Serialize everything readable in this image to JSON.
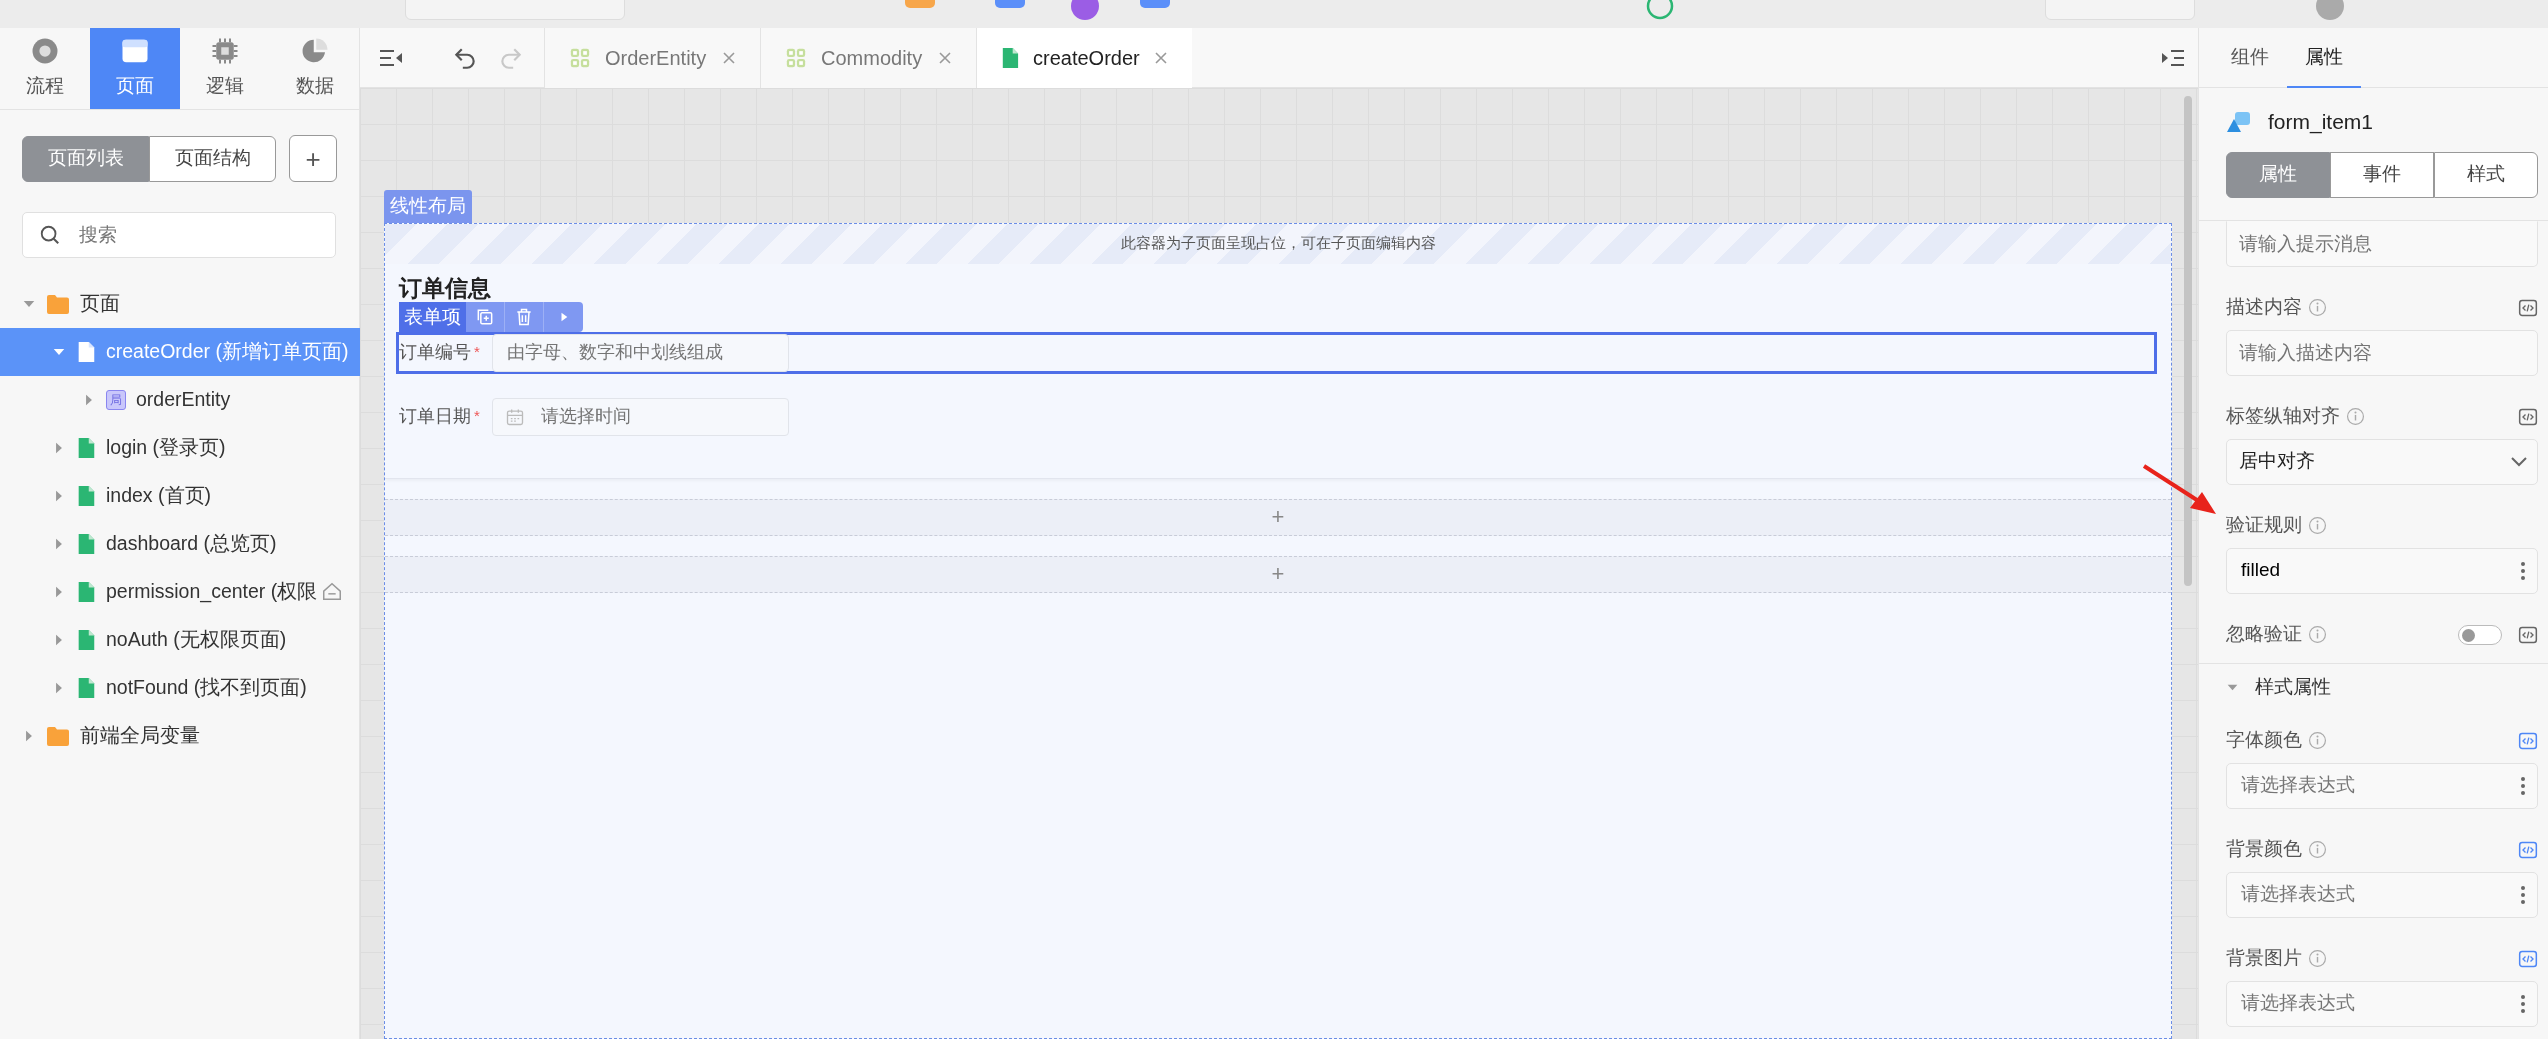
{
  "mode_tabs": [
    {
      "label": "流程",
      "selected": false
    },
    {
      "label": "页面",
      "selected": true
    },
    {
      "label": "逻辑",
      "selected": false
    },
    {
      "label": "数据",
      "selected": false
    }
  ],
  "sidebar": {
    "segments": [
      {
        "label": "页面列表",
        "selected": true
      },
      {
        "label": "页面结构",
        "selected": false
      }
    ],
    "add_button": "+",
    "search": {
      "placeholder": "搜索"
    },
    "tree": [
      {
        "label": "页面",
        "kind": "folder",
        "expanded": true,
        "selected": false,
        "children": [
          {
            "label": "createOrder (新增订单页面)",
            "kind": "page",
            "expanded": true,
            "selected": true,
            "children": [
              {
                "label": "orderEntity",
                "kind": "variable",
                "badge": "局",
                "expanded": false,
                "selected": false
              }
            ]
          },
          {
            "label": "login (登录页)",
            "kind": "page",
            "expanded": false,
            "selected": false
          },
          {
            "label": "index (首页)",
            "kind": "page",
            "expanded": false,
            "selected": false
          },
          {
            "label": "dashboard (总览页)",
            "kind": "page",
            "expanded": false,
            "selected": false
          },
          {
            "label": "permission_center (权限",
            "kind": "page",
            "expanded": false,
            "selected": false,
            "home": true
          },
          {
            "label": "noAuth (无权限页面)",
            "kind": "page",
            "expanded": false,
            "selected": false
          },
          {
            "label": "notFound (找不到页面)",
            "kind": "page",
            "expanded": false,
            "selected": false
          }
        ]
      },
      {
        "label": "前端全局变量",
        "kind": "folder",
        "expanded": false,
        "selected": false
      }
    ]
  },
  "editor": {
    "history": [
      {
        "kind": "undo",
        "disabled": false
      },
      {
        "kind": "redo",
        "disabled": true
      }
    ],
    "tabs": [
      {
        "label": "OrderEntity",
        "kind": "entity",
        "selected": false
      },
      {
        "label": "Commodity",
        "kind": "entity",
        "selected": false
      },
      {
        "label": "createOrder",
        "kind": "page",
        "selected": true
      }
    ]
  },
  "canvas": {
    "layout_tag": "线性布局",
    "banner": "此容器为子页面呈现占位，可在子页面编辑内容",
    "form_title": "订单信息",
    "item_toolbar": {
      "label": "表单项"
    },
    "fields": [
      {
        "label": "订单编号",
        "required_mark": "*",
        "kind": "text",
        "placeholder": "由字母、数字和中划线组成",
        "selected": true
      },
      {
        "label": "订单日期",
        "required_mark": "*",
        "kind": "date",
        "placeholder": "请选择时间",
        "selected": false
      }
    ],
    "add_rows": [
      "+",
      "+"
    ]
  },
  "inspector": {
    "tabs": [
      {
        "label": "组件",
        "selected": false
      },
      {
        "label": "属性",
        "selected": true
      }
    ],
    "component": "form_item1",
    "segments": [
      {
        "label": "属性",
        "selected": true
      },
      {
        "label": "事件",
        "selected": false
      },
      {
        "label": "样式",
        "selected": false
      }
    ],
    "properties": [
      {
        "kind": "input",
        "placeholder": "请输入提示消息"
      },
      {
        "kind": "input",
        "label": "描述内容",
        "placeholder": "请输入描述内容",
        "code_active": false
      },
      {
        "kind": "select",
        "label": "标签纵轴对齐",
        "value": "居中对齐",
        "code_active": false
      },
      {
        "kind": "rule",
        "label": "验证规则",
        "value": "filled"
      },
      {
        "kind": "toggle",
        "label": "忽略验证",
        "on": false,
        "code_active": false
      }
    ],
    "style_section": {
      "title": "样式属性",
      "expanded": true,
      "properties": [
        {
          "kind": "expression",
          "label": "字体颜色",
          "placeholder": "请选择表达式",
          "code_active": true
        },
        {
          "kind": "expression",
          "label": "背景颜色",
          "placeholder": "请选择表达式",
          "code_active": true
        },
        {
          "kind": "expression",
          "label": "背景图片",
          "placeholder": "请选择表达式",
          "code_active": true
        }
      ]
    }
  }
}
